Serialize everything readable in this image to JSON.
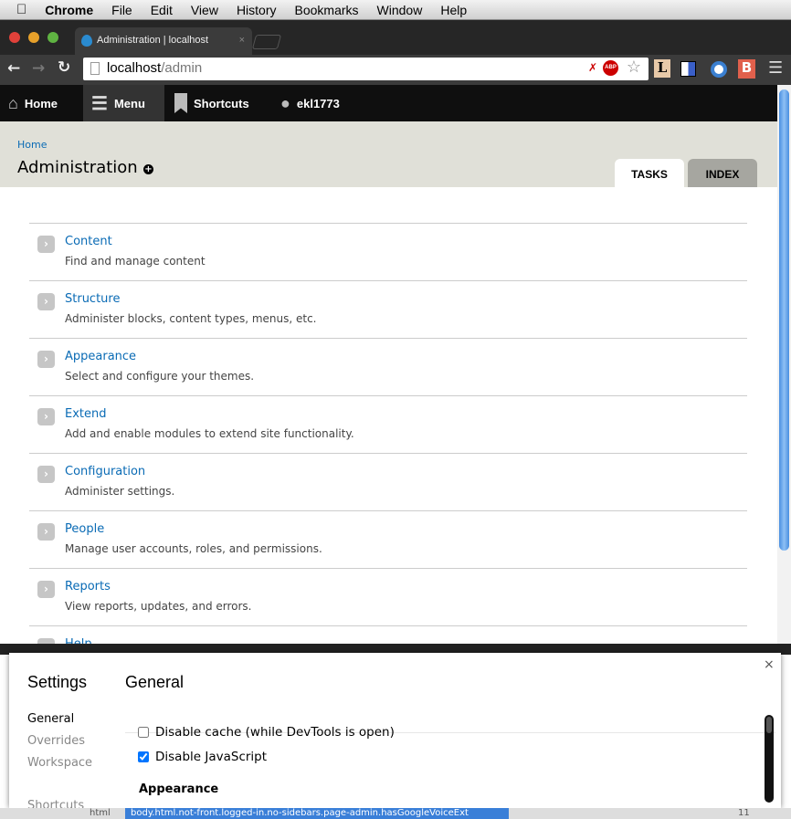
{
  "menubar": {
    "app": "Chrome",
    "items": [
      "File",
      "Edit",
      "View",
      "History",
      "Bookmarks",
      "Window",
      "Help"
    ]
  },
  "browser": {
    "tab_title": "Administration | localhost",
    "url_host": "localhost",
    "url_path": "/admin",
    "extensions": [
      "L",
      "B"
    ]
  },
  "toolbar": {
    "home": "Home",
    "menu": "Menu",
    "shortcuts": "Shortcuts",
    "user": "ekl1773"
  },
  "header": {
    "breadcrumb": "Home",
    "title": "Administration",
    "tabs": [
      "TASKS",
      "INDEX"
    ]
  },
  "items": [
    {
      "title": "Content",
      "desc": "Find and manage content"
    },
    {
      "title": "Structure",
      "desc": "Administer blocks, content types, menus, etc."
    },
    {
      "title": "Appearance",
      "desc": "Select and configure your themes."
    },
    {
      "title": "Extend",
      "desc": "Add and enable modules to extend site functionality."
    },
    {
      "title": "Configuration",
      "desc": "Administer settings."
    },
    {
      "title": "People",
      "desc": "Manage user accounts, roles, and permissions."
    },
    {
      "title": "Reports",
      "desc": "View reports, updates, and errors."
    },
    {
      "title": "Help",
      "desc": ""
    }
  ],
  "devtools": {
    "settings_title": "Settings",
    "nav": [
      "General",
      "Overrides",
      "Workspace",
      "Shortcuts"
    ],
    "section": "General",
    "close": "×",
    "options": [
      {
        "label": "Disable cache (while DevTools is open)",
        "checked": false
      },
      {
        "label": "Disable JavaScript",
        "checked": true
      }
    ],
    "subheading": "Appearance",
    "status_tag": "html",
    "status_path": "body.html.not-front.logged-in.no-sidebars.page-admin.hasGoogleVoiceExt",
    "warnings": "11"
  }
}
